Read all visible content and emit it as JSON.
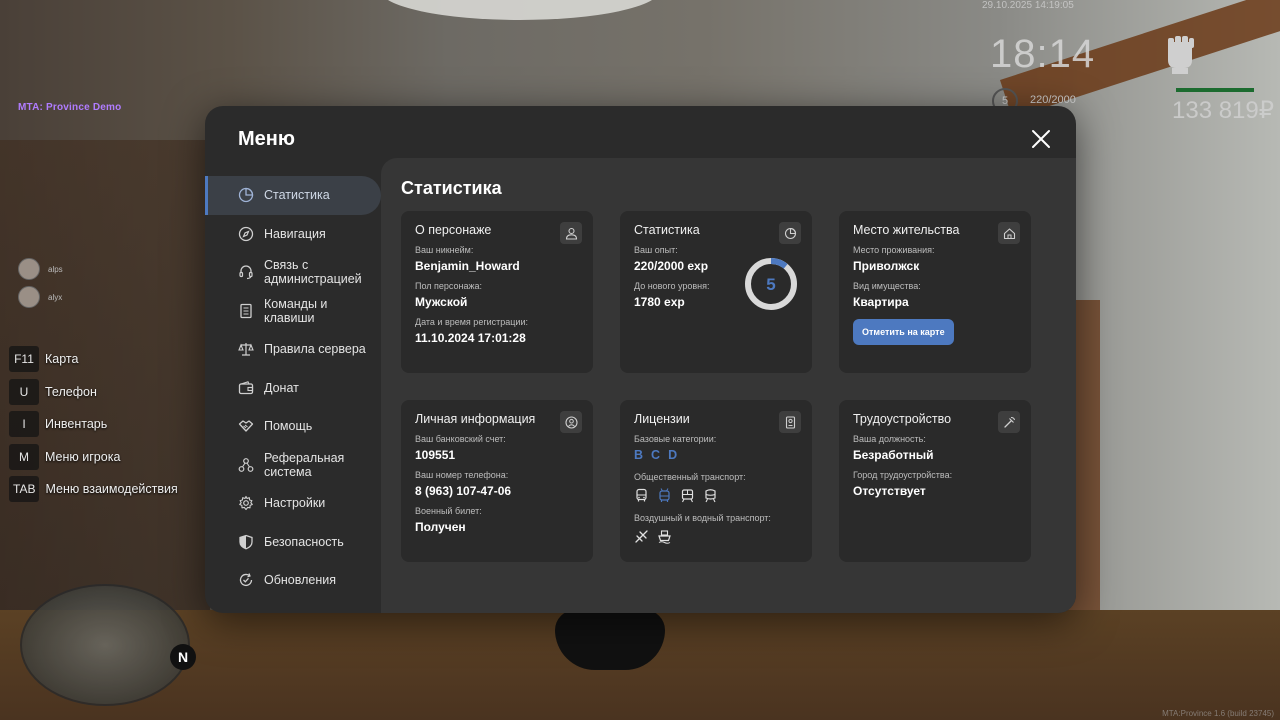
{
  "hud": {
    "server_title": "MTA: Province Demo",
    "datetime": "29.10.2025 14:19:05",
    "time": "18:14",
    "level": "5",
    "exp": "220/2000",
    "money": "133 819₽",
    "players": [
      {
        "name": "alps"
      },
      {
        "name": "alyx"
      }
    ],
    "hotkeys": [
      {
        "key": "F11",
        "label": "Карта"
      },
      {
        "key": "U",
        "label": "Телефон"
      },
      {
        "key": "I",
        "label": "Инвентарь"
      },
      {
        "key": "M",
        "label": "Меню игрока"
      },
      {
        "key": "TAB",
        "label": "Меню взаимодействия"
      }
    ],
    "compass": "N",
    "watermark": "MTA:Province 1.6 (build 23745)"
  },
  "menu": {
    "title": "Меню",
    "sidebar": [
      {
        "label": "Статистика",
        "icon": "pie-chart-icon",
        "active": true
      },
      {
        "label": "Навигация",
        "icon": "compass-icon"
      },
      {
        "label": "Связь с администрацией",
        "icon": "headset-icon"
      },
      {
        "label": "Команды и клавиши",
        "icon": "document-icon"
      },
      {
        "label": "Правила сервера",
        "icon": "scales-icon"
      },
      {
        "label": "Донат",
        "icon": "wallet-icon"
      },
      {
        "label": "Помощь",
        "icon": "handshake-icon"
      },
      {
        "label": "Реферальная система",
        "icon": "network-icon"
      },
      {
        "label": "Настройки",
        "icon": "gear-icon"
      },
      {
        "label": "Безопасность",
        "icon": "shield-icon"
      },
      {
        "label": "Обновления",
        "icon": "refresh-check-icon"
      }
    ],
    "content_title": "Статистика",
    "cards": {
      "character": {
        "title": "О персонаже",
        "nickname_label": "Ваш никнейм:",
        "nickname": "Benjamin_Howard",
        "gender_label": "Пол персонажа:",
        "gender": "Мужской",
        "reg_label": "Дата и время регистрации:",
        "reg_date": "11.10.2024 17:01:28"
      },
      "stats": {
        "title": "Статистика",
        "exp_label": "Ваш опыт:",
        "exp": "220/2000 exp",
        "next_label": "До нового уровня:",
        "next": "1780 exp",
        "level": "5",
        "progress": 0.11
      },
      "residence": {
        "title": "Место жительства",
        "place_label": "Место проживания:",
        "place": "Приволжск",
        "property_label": "Вид имущества:",
        "property": "Квартира",
        "button": "Отметить на карте"
      },
      "personal": {
        "title": "Личная информация",
        "bank_label": "Ваш банковский счет:",
        "bank": "109551",
        "phone_label": "Ваш номер телефона:",
        "phone": "8 (963) 107-47-06",
        "military_label": "Военный билет:",
        "military": "Получен"
      },
      "licenses": {
        "title": "Лицензии",
        "base_label": "Базовые категории:",
        "categories": [
          "B",
          "C",
          "D"
        ],
        "public_label": "Общественный транспорт:",
        "air_label": "Воздушный и водный транспорт:"
      },
      "employment": {
        "title": "Трудоустройство",
        "position_label": "Ваша должность:",
        "position": "Безработный",
        "city_label": "Город трудоустройства:",
        "city": "Отсутствует"
      }
    }
  },
  "colors": {
    "accent": "#4d79c0",
    "panel": "#2b2b2b",
    "content": "#363636",
    "card": "#2a2a2a"
  }
}
